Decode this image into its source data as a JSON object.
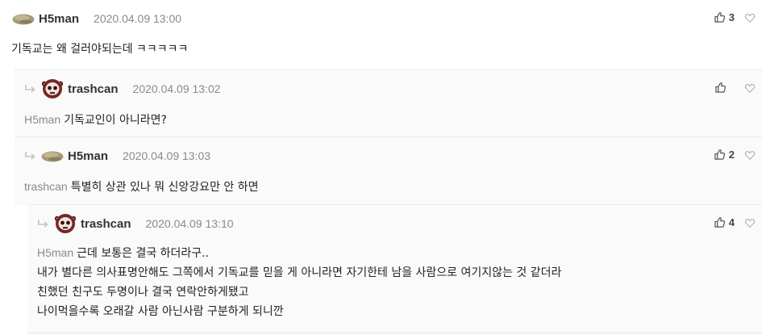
{
  "comments": [
    {
      "nick": "H5man",
      "date": "2020.04.09 13:00",
      "likes": "3",
      "avatar": "rock-avatar",
      "mention": "",
      "lines": [
        "기독교는 왜 걸러야되는데 ㅋㅋㅋㅋㅋ"
      ]
    },
    {
      "nick": "trashcan",
      "date": "2020.04.09 13:02",
      "likes": "",
      "avatar": "skull-avatar",
      "mention": "H5man",
      "lines": [
        "기독교인이 아니라면?"
      ]
    },
    {
      "nick": "H5man",
      "date": "2020.04.09 13:03",
      "likes": "2",
      "avatar": "rock-avatar",
      "mention": "trashcan",
      "lines": [
        "특별히 상관 있나 뭐 신앙강요만 안 하면"
      ]
    },
    {
      "nick": "trashcan",
      "date": "2020.04.09 13:10",
      "likes": "4",
      "avatar": "skull-avatar",
      "mention": "H5man",
      "lines": [
        "근데 보통은 결국 하더라구..",
        "내가 별다른 의사표명안해도 그쪽에서 기독교를 믿을 게 아니라면 자기한테 남을 사람으로 여기지않는 것 같더라",
        "친했던 친구도 두명이나 결국 연락안하게됐고",
        "나이먹을수록 오래갈 사람 아닌사람 구분하게 되니깐"
      ]
    }
  ],
  "icons": {
    "like": "thumbs-up-icon",
    "dislike": "heart-icon",
    "reply": "reply-arrow-icon"
  },
  "colors": {
    "nick": "#333333",
    "date": "#8a8a8a",
    "mention": "#8a8a8a",
    "reply_bg": "#fafafa"
  }
}
